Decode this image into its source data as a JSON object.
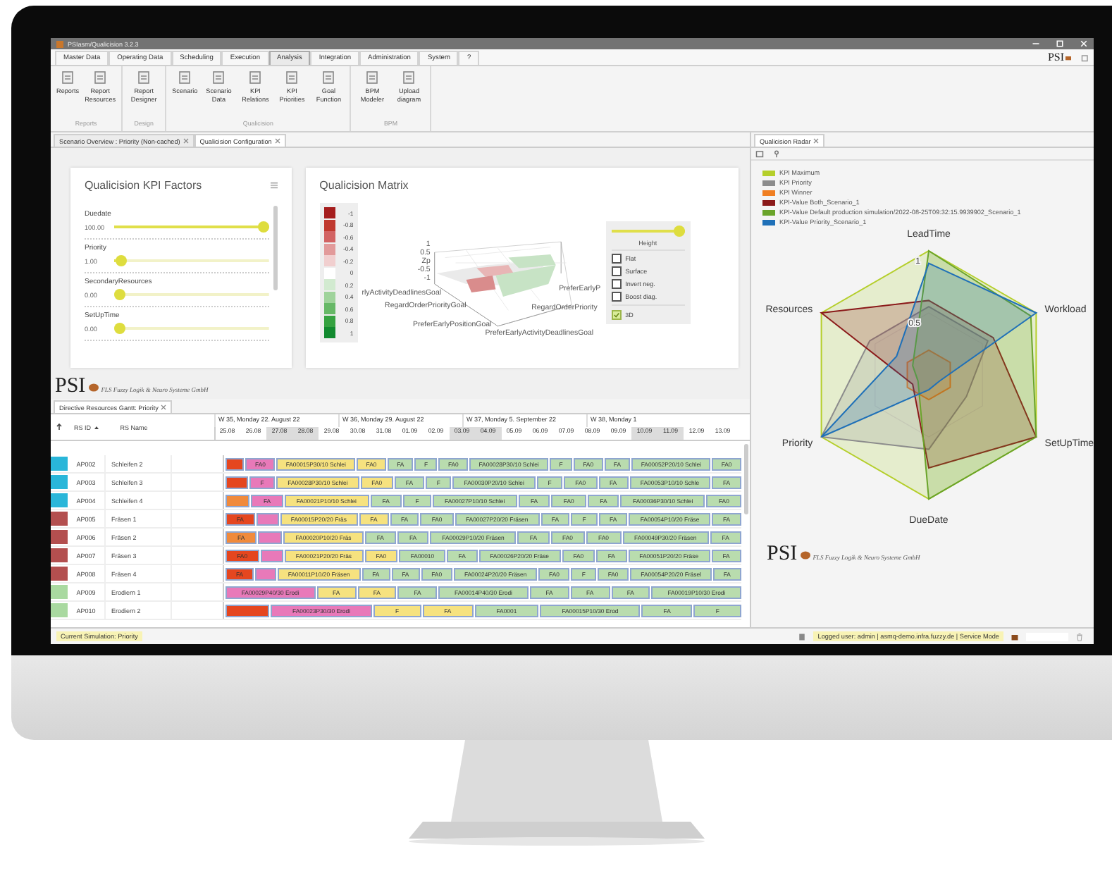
{
  "window": {
    "title": "PSIasm/Qualicision 3.2.3"
  },
  "menu_tabs": [
    {
      "label": "Master Data",
      "selected": false
    },
    {
      "label": "Operating Data",
      "selected": false
    },
    {
      "label": "Scheduling",
      "selected": false
    },
    {
      "label": "Execution",
      "selected": false
    },
    {
      "label": "Analysis",
      "selected": true
    },
    {
      "label": "Integration",
      "selected": false
    },
    {
      "label": "Administration",
      "selected": false
    },
    {
      "label": "System",
      "selected": false
    },
    {
      "label": "?",
      "selected": false
    }
  ],
  "brand": {
    "logo": "PSI"
  },
  "ribbon": [
    {
      "group": "Reports",
      "buttons": [
        "Reports",
        "Report Resources"
      ]
    },
    {
      "group": "Design",
      "buttons": [
        "Report Designer"
      ]
    },
    {
      "group": "Qualicision",
      "buttons": [
        "Scenario",
        "Scenario Data",
        "KPI Relations",
        "KPI Priorities",
        "Goal Function"
      ]
    },
    {
      "group": "BPM",
      "buttons": [
        "BPM Modeler",
        "Upload diagram"
      ]
    }
  ],
  "editor_tabs": [
    {
      "label": "Scenario Overview : Priority (Non-cached)",
      "selected": false
    },
    {
      "label": "Qualicision Configuration",
      "selected": true
    }
  ],
  "kpi_factors": {
    "title": "Qualicision KPI Factors",
    "items": [
      {
        "name": "Duedate",
        "value": "100.00",
        "level": 1
      },
      {
        "name": "Priority",
        "value": "1.00",
        "level": 0.01
      },
      {
        "name": "SecondaryResources",
        "value": "0.00",
        "level": 0
      },
      {
        "name": "SetUpTime",
        "value": "0.00",
        "level": 0
      }
    ]
  },
  "matrix": {
    "title": "Qualicision Matrix",
    "legend": [
      {
        "value": "-1",
        "color": "#a51d1d"
      },
      {
        "value": "-0.8",
        "color": "#c0392f"
      },
      {
        "value": "-0.6",
        "color": "#d26363"
      },
      {
        "value": "-0.4",
        "color": "#e29a9a"
      },
      {
        "value": "-0.2",
        "color": "#f1cfcf"
      },
      {
        "value": "0",
        "color": "#ffffff"
      },
      {
        "value": "0.2",
        "color": "#d2ead0"
      },
      {
        "value": "0.4",
        "color": "#9fd39b"
      },
      {
        "value": "0.6",
        "color": "#66b866"
      },
      {
        "value": "0.8",
        "color": "#35a240"
      },
      {
        "value": "1",
        "color": "#128a2f"
      }
    ],
    "z_ticks": [
      "1",
      "0.5",
      "Zp",
      "-0.5",
      "-1"
    ],
    "axis_labels": [
      "rlyActivityDeadlinesGoal",
      "RegardOrderPriorityGoal",
      "PreferEarlyPositionGoal",
      "PreferEarlyP",
      "RegardOrderPriority",
      "PreferEarlyActivityDeadlinesGoal"
    ],
    "height": {
      "label": "Height",
      "level": 1
    },
    "options": [
      {
        "label": "Flat",
        "checked": false
      },
      {
        "label": "Surface",
        "checked": false
      },
      {
        "label": "Invert neg.",
        "checked": false
      },
      {
        "label": "Boost diag.",
        "checked": false
      },
      {
        "label": "3D",
        "checked": true
      }
    ]
  },
  "company_logo": {
    "logo": "PSI",
    "company": "FLS Fuzzy Logik & Neuro Systeme GmbH"
  },
  "gantt": {
    "tab": "Directive Resources Gantt: Priority",
    "columns": [
      "RS ID",
      "RS Name"
    ],
    "weeks": [
      "W 35, Monday 22. August 22",
      "W 36, Monday 29. August 22",
      "W 37, Monday 5. September 22",
      "W 38, Monday 1"
    ],
    "days": [
      {
        "label": "25.08",
        "weekend": false
      },
      {
        "label": "26.08",
        "weekend": false
      },
      {
        "label": "27.08",
        "weekend": true
      },
      {
        "label": "28.08",
        "weekend": true
      },
      {
        "label": "29.08",
        "weekend": false
      },
      {
        "label": "30.08",
        "weekend": false
      },
      {
        "label": "31.08",
        "weekend": false
      },
      {
        "label": "01.09",
        "weekend": false
      },
      {
        "label": "02.09",
        "weekend": false
      },
      {
        "label": "03.09",
        "weekend": true
      },
      {
        "label": "04.09",
        "weekend": true
      },
      {
        "label": "05.09",
        "weekend": false
      },
      {
        "label": "06.09",
        "weekend": false
      },
      {
        "label": "07.09",
        "weekend": false
      },
      {
        "label": "08.09",
        "weekend": false
      },
      {
        "label": "09.09",
        "weekend": false
      },
      {
        "label": "10.09",
        "weekend": true
      },
      {
        "label": "11.09",
        "weekend": true
      },
      {
        "label": "12.09",
        "weekend": false
      },
      {
        "label": "13.09",
        "weekend": false
      }
    ],
    "rows": [
      {
        "id": "AP002",
        "name": "Schleifen 2",
        "color": "#29b6d9",
        "bars": [
          {
            "color": "#e5461f"
          },
          {
            "label": "FA0",
            "color": "#e879b9"
          },
          {
            "label": "FA00015P30/10 Schlei",
            "color": "#f6e27f"
          },
          {
            "label": "FA0",
            "color": "#f6e27f"
          },
          {
            "label": "FA",
            "color": "#b9dcae"
          },
          {
            "label": "F",
            "color": "#b9dcae"
          },
          {
            "label": "FA0",
            "color": "#b9dcae"
          },
          {
            "label": "FA00028P30/10 Schlei",
            "color": "#b9dcae"
          },
          {
            "label": "F",
            "color": "#b9dcae"
          },
          {
            "label": "FA0",
            "color": "#b9dcae"
          },
          {
            "label": "FA",
            "color": "#b9dcae"
          },
          {
            "label": "FA00052P20/10 Schlei",
            "color": "#b9dcae"
          },
          {
            "label": "FA0",
            "color": "#b9dcae"
          }
        ]
      },
      {
        "id": "AP003",
        "name": "Schleifen 3",
        "color": "#29b6d9",
        "bars": [
          {
            "color": "#e5461f"
          },
          {
            "label": "F",
            "color": "#e879b9"
          },
          {
            "label": "FA00028P30/10 Schlei",
            "color": "#f6e27f"
          },
          {
            "label": "FA0",
            "color": "#f6e27f"
          },
          {
            "label": "FA",
            "color": "#b9dcae"
          },
          {
            "label": "F",
            "color": "#b9dcae"
          },
          {
            "label": "FA00030P20/10 Schlei",
            "color": "#b9dcae"
          },
          {
            "label": "F",
            "color": "#b9dcae"
          },
          {
            "label": "FA0",
            "color": "#b9dcae"
          },
          {
            "label": "FA",
            "color": "#b9dcae"
          },
          {
            "label": "FA00053P10/10 Schle",
            "color": "#b9dcae"
          },
          {
            "label": "FA",
            "color": "#b9dcae"
          }
        ]
      },
      {
        "id": "AP004",
        "name": "Schleifen 4",
        "color": "#29b6d9",
        "bars": [
          {
            "color": "#f08a3c"
          },
          {
            "label": "FA",
            "color": "#e879b9"
          },
          {
            "label": "FA00021P10/10 Schlei",
            "color": "#f6e27f"
          },
          {
            "label": "FA",
            "color": "#b9dcae"
          },
          {
            "label": "F",
            "color": "#b9dcae"
          },
          {
            "label": "FA00027P10/10 Schlei",
            "color": "#b9dcae"
          },
          {
            "label": "FA",
            "color": "#b9dcae"
          },
          {
            "label": "FA0",
            "color": "#b9dcae"
          },
          {
            "label": "FA",
            "color": "#b9dcae"
          },
          {
            "label": "FA00036P30/10 Schlei",
            "color": "#b9dcae"
          },
          {
            "label": "FA0",
            "color": "#b9dcae"
          }
        ]
      },
      {
        "id": "AP005",
        "name": "Fräsen 1",
        "color": "#b34f4f",
        "bars": [
          {
            "label": "FA",
            "color": "#e5461f"
          },
          {
            "color": "#e879b9"
          },
          {
            "label": "FA00015P20/20 Fräs",
            "color": "#f6e27f"
          },
          {
            "label": "FA",
            "color": "#f6e27f"
          },
          {
            "label": "FA",
            "color": "#b9dcae"
          },
          {
            "label": "FA0",
            "color": "#b9dcae"
          },
          {
            "label": "FA00027P20/20 Fräsen",
            "color": "#b9dcae"
          },
          {
            "label": "FA",
            "color": "#b9dcae"
          },
          {
            "label": "F",
            "color": "#b9dcae"
          },
          {
            "label": "FA",
            "color": "#b9dcae"
          },
          {
            "label": "FA00054P10/20 Fräse",
            "color": "#b9dcae"
          },
          {
            "label": "FA",
            "color": "#b9dcae"
          }
        ]
      },
      {
        "id": "AP006",
        "name": "Fräsen 2",
        "color": "#b34f4f",
        "bars": [
          {
            "label": "FA",
            "color": "#f08a3c"
          },
          {
            "color": "#e879b9"
          },
          {
            "label": "FA00020P10/20 Fräs",
            "color": "#f6e27f"
          },
          {
            "label": "FA",
            "color": "#b9dcae"
          },
          {
            "label": "FA",
            "color": "#b9dcae"
          },
          {
            "label": "FA00029P10/20 Fräsen",
            "color": "#b9dcae"
          },
          {
            "label": "FA",
            "color": "#b9dcae"
          },
          {
            "label": "FA0",
            "color": "#b9dcae"
          },
          {
            "label": "FA0",
            "color": "#b9dcae"
          },
          {
            "label": "FA00049P30/20 Fräsen",
            "color": "#b9dcae"
          },
          {
            "label": "FA",
            "color": "#b9dcae"
          }
        ]
      },
      {
        "id": "AP007",
        "name": "Fräsen 3",
        "color": "#b34f4f",
        "bars": [
          {
            "label": "FA0",
            "color": "#e5461f"
          },
          {
            "color": "#e879b9"
          },
          {
            "label": "FA00021P20/20 Fräs",
            "color": "#f6e27f"
          },
          {
            "label": "FA0",
            "color": "#f6e27f"
          },
          {
            "label": "FA00010",
            "color": "#b9dcae"
          },
          {
            "label": "FA",
            "color": "#b9dcae"
          },
          {
            "label": "FA00026P20/20 Fräse",
            "color": "#b9dcae"
          },
          {
            "label": "FA0",
            "color": "#b9dcae"
          },
          {
            "label": "FA",
            "color": "#b9dcae"
          },
          {
            "label": "FA00051P20/20 Fräse",
            "color": "#b9dcae"
          },
          {
            "label": "FA",
            "color": "#b9dcae"
          }
        ]
      },
      {
        "id": "AP008",
        "name": "Fräsen 4",
        "color": "#b34f4f",
        "bars": [
          {
            "label": "FA",
            "color": "#e5461f"
          },
          {
            "color": "#e879b9"
          },
          {
            "label": "FA00011P10/20 Fräsen",
            "color": "#f6e27f"
          },
          {
            "label": "FA",
            "color": "#b9dcae"
          },
          {
            "label": "FA",
            "color": "#b9dcae"
          },
          {
            "label": "FA0",
            "color": "#b9dcae"
          },
          {
            "label": "FA00024P20/20 Fräsen",
            "color": "#b9dcae"
          },
          {
            "label": "FA0",
            "color": "#b9dcae"
          },
          {
            "label": "F",
            "color": "#b9dcae"
          },
          {
            "label": "FA0",
            "color": "#b9dcae"
          },
          {
            "label": "FA00054P20/20 Fräsel",
            "color": "#b9dcae"
          },
          {
            "label": "FA",
            "color": "#b9dcae"
          }
        ]
      },
      {
        "id": "AP009",
        "name": "Erodiern 1",
        "color": "#a9d9a0",
        "bars": [
          {
            "label": "FA00029P40/30 Erodi",
            "color": "#e879b9"
          },
          {
            "label": "FA",
            "color": "#f6e27f"
          },
          {
            "label": "FA",
            "color": "#f6e27f"
          },
          {
            "label": "FA",
            "color": "#b9dcae"
          },
          {
            "label": "FA00014P40/30 Erodi",
            "color": "#b9dcae"
          },
          {
            "label": "FA",
            "color": "#b9dcae"
          },
          {
            "label": "FA",
            "color": "#b9dcae"
          },
          {
            "label": "FA",
            "color": "#b9dcae"
          },
          {
            "label": "FA00019P10/30 Erodi",
            "color": "#b9dcae"
          }
        ]
      },
      {
        "id": "AP010",
        "name": "Erodiern 2",
        "color": "#a9d9a0",
        "bars": [
          {
            "color": "#e5461f"
          },
          {
            "label": "FA00023P30/30 Erodi",
            "color": "#e879b9"
          },
          {
            "label": "F",
            "color": "#f6e27f"
          },
          {
            "label": "FA",
            "color": "#f6e27f"
          },
          {
            "label": "FA0001",
            "color": "#b9dcae"
          },
          {
            "label": "FA00015P10/30 Erod",
            "color": "#b9dcae"
          },
          {
            "label": "FA",
            "color": "#b9dcae"
          },
          {
            "label": "F",
            "color": "#b9dcae"
          }
        ]
      }
    ]
  },
  "radar": {
    "tab": "Qualicision Radar",
    "legend": [
      {
        "label": "KPI Maximum",
        "color": "#b5cf2a"
      },
      {
        "label": "KPI Priority",
        "color": "#8c8c8c"
      },
      {
        "label": "KPI Winner",
        "color": "#f07f22"
      },
      {
        "label": "KPI-Value Both_Scenario_1",
        "color": "#8b1a1a"
      },
      {
        "label": "KPI-Value Default production simulation/2022-08-25T09:32:15.9939902_Scenario_1",
        "color": "#6aa42a"
      },
      {
        "label": "KPI-Value Priority_Scenario_1",
        "color": "#1f70b8"
      }
    ],
    "axes": [
      "LeadTime",
      "Workload",
      "SetUpTime",
      "DueDate",
      "Priority",
      "Resources"
    ],
    "ticks": [
      "1",
      "0.5"
    ],
    "logo": "PSI",
    "company": "FLS Fuzzy Logik & Neuro Systeme GmbH"
  },
  "status_bar": {
    "simulation": "Current Simulation: Priority",
    "session": "Logged user: admin | asmq-demo.infra.fuzzy.de | Service Mode"
  }
}
